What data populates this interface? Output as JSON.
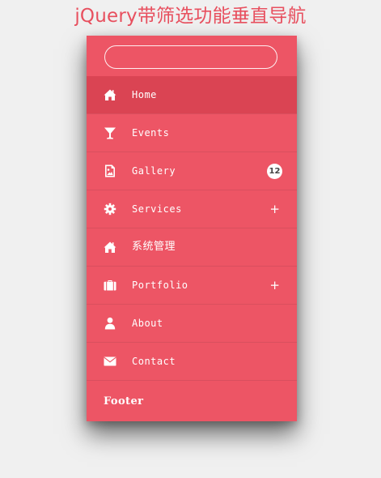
{
  "header": {
    "title": "jQuery带筛选功能垂直导航"
  },
  "search": {
    "value": "",
    "placeholder": ""
  },
  "menu": {
    "items": [
      {
        "label": "Home",
        "icon": "home-icon",
        "active": true
      },
      {
        "label": "Events",
        "icon": "cocktail-glass-icon"
      },
      {
        "label": "Gallery",
        "icon": "picture-file-icon",
        "badge": "12"
      },
      {
        "label": "Services",
        "icon": "gear-icon",
        "expand": "+"
      },
      {
        "label": "系统管理",
        "icon": "home-icon"
      },
      {
        "label": "Portfolio",
        "icon": "briefcase-icon",
        "expand": "+"
      },
      {
        "label": "About",
        "icon": "user-icon"
      },
      {
        "label": "Contact",
        "icon": "envelope-icon"
      }
    ]
  },
  "footer": {
    "label": "Footer"
  },
  "colors": {
    "accent": "#ed5565",
    "active": "#da4453",
    "title": "#e8505f",
    "background": "#f0f0f0"
  }
}
